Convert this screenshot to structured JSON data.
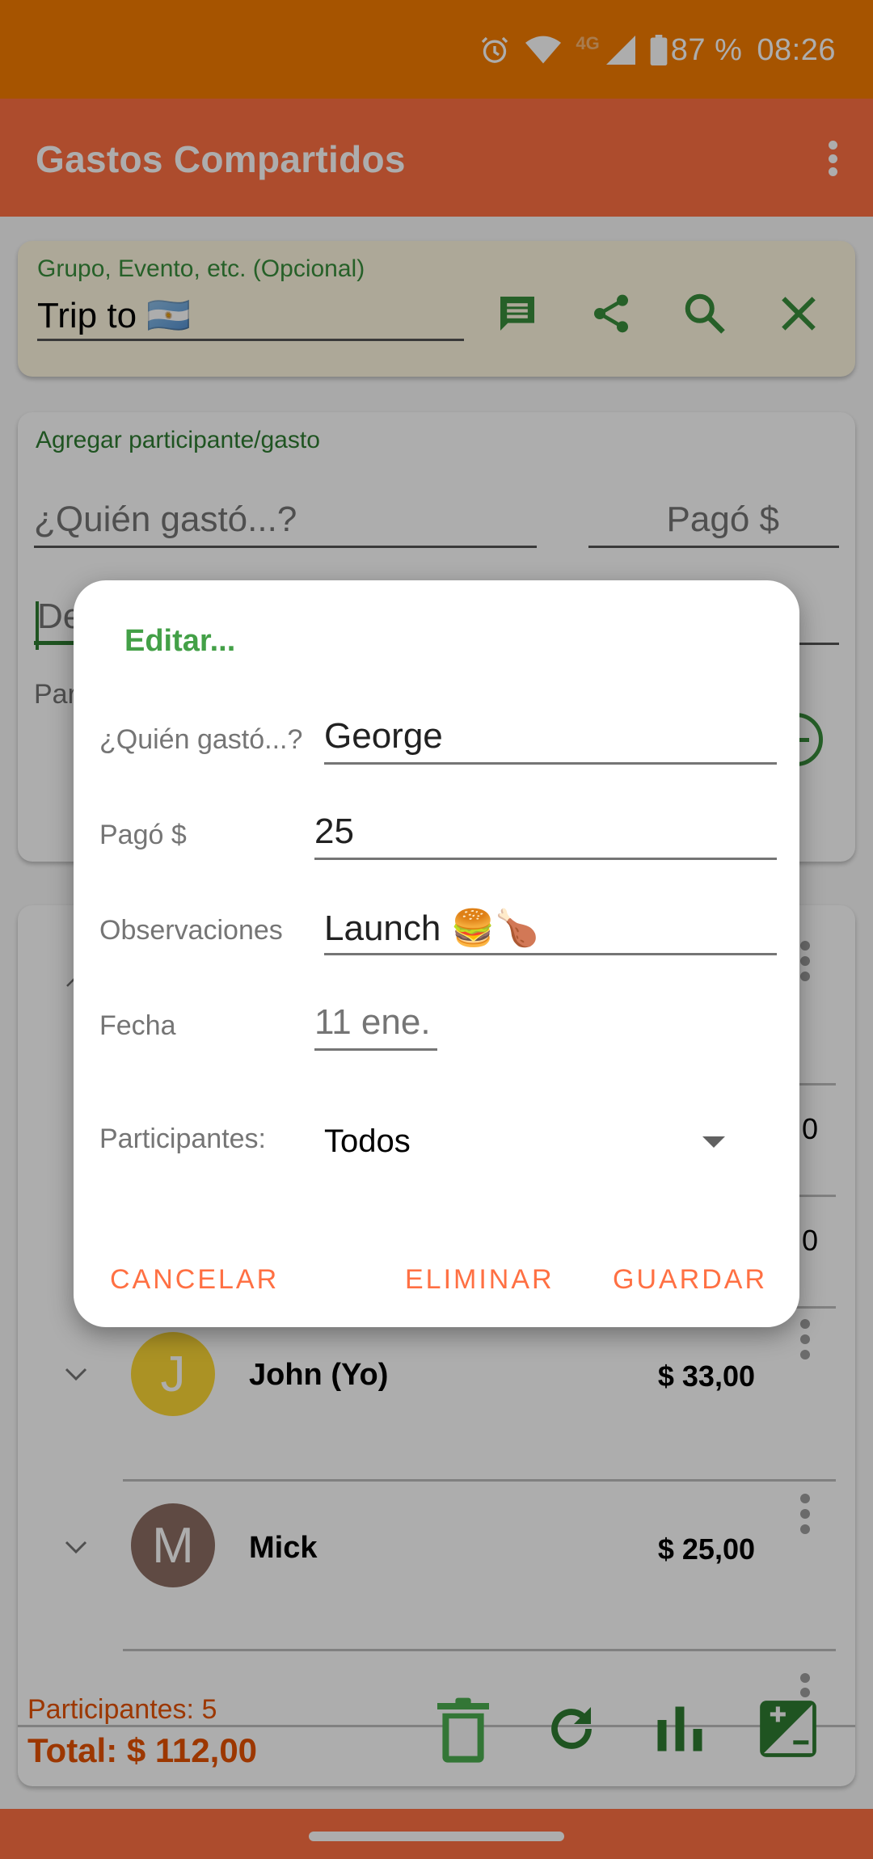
{
  "status_bar": {
    "network": "4G",
    "battery": "87 %",
    "time": "08:26",
    "icons": [
      "alarm-icon",
      "wifi-icon",
      "signal-icon",
      "battery-icon"
    ]
  },
  "app_bar": {
    "title": "Gastos Compartidos",
    "menu_icon": "more-vert-icon"
  },
  "group_card": {
    "label": "Grupo, Evento, etc. (Opcional)",
    "value": "Trip to 🇦🇷",
    "actions": [
      {
        "name": "notes",
        "icon": "message-icon"
      },
      {
        "name": "share",
        "icon": "share-icon"
      },
      {
        "name": "search",
        "icon": "search-icon"
      },
      {
        "name": "clear",
        "icon": "close-icon"
      }
    ]
  },
  "add_card": {
    "label": "Agregar participante/gasto",
    "who_placeholder": "¿Quién gastó...?",
    "paid_placeholder": "Pagó $",
    "description_placeholder_partial": "De",
    "participants_label_partial": "Par",
    "add_icon": "add-circle-icon"
  },
  "participants_list": {
    "partial_amounts": [
      "0",
      "0"
    ],
    "rows": [
      {
        "name": "John (Yo)",
        "initial": "J",
        "amount": "$ 33,00",
        "avatar_color": "#fdd835"
      },
      {
        "name": "Mick",
        "initial": "M",
        "amount": "$ 25,00",
        "avatar_color": "#8d6e63"
      }
    ]
  },
  "footer": {
    "participants_count": "Participantes: 5",
    "total": "Total: $ 112,00",
    "actions": [
      {
        "name": "delete",
        "icon": "trash-icon"
      },
      {
        "name": "refresh",
        "icon": "refresh-icon"
      },
      {
        "name": "stats",
        "icon": "bar-chart-icon"
      },
      {
        "name": "balance",
        "icon": "plus-minus-icon"
      }
    ]
  },
  "dialog": {
    "title": "Editar...",
    "fields": {
      "who": {
        "label": "¿Quién gastó...?",
        "value": "George"
      },
      "paid": {
        "label": "Pagó $",
        "value": "25"
      },
      "notes": {
        "label": "Observaciones",
        "value": "Launch 🍔🍗"
      },
      "date": {
        "label": "Fecha",
        "value": "11 ene."
      },
      "participants": {
        "label": "Participantes:",
        "value": "Todos"
      }
    },
    "buttons": {
      "cancel": "CANCELAR",
      "delete": "ELIMINAR",
      "save": "GUARDAR"
    }
  },
  "colors": {
    "primary": "#ff7043",
    "status_bar": "#f57c00",
    "accent_green": "#388e3c",
    "dialog_button": "#ff7043",
    "total_text": "#e65100"
  }
}
